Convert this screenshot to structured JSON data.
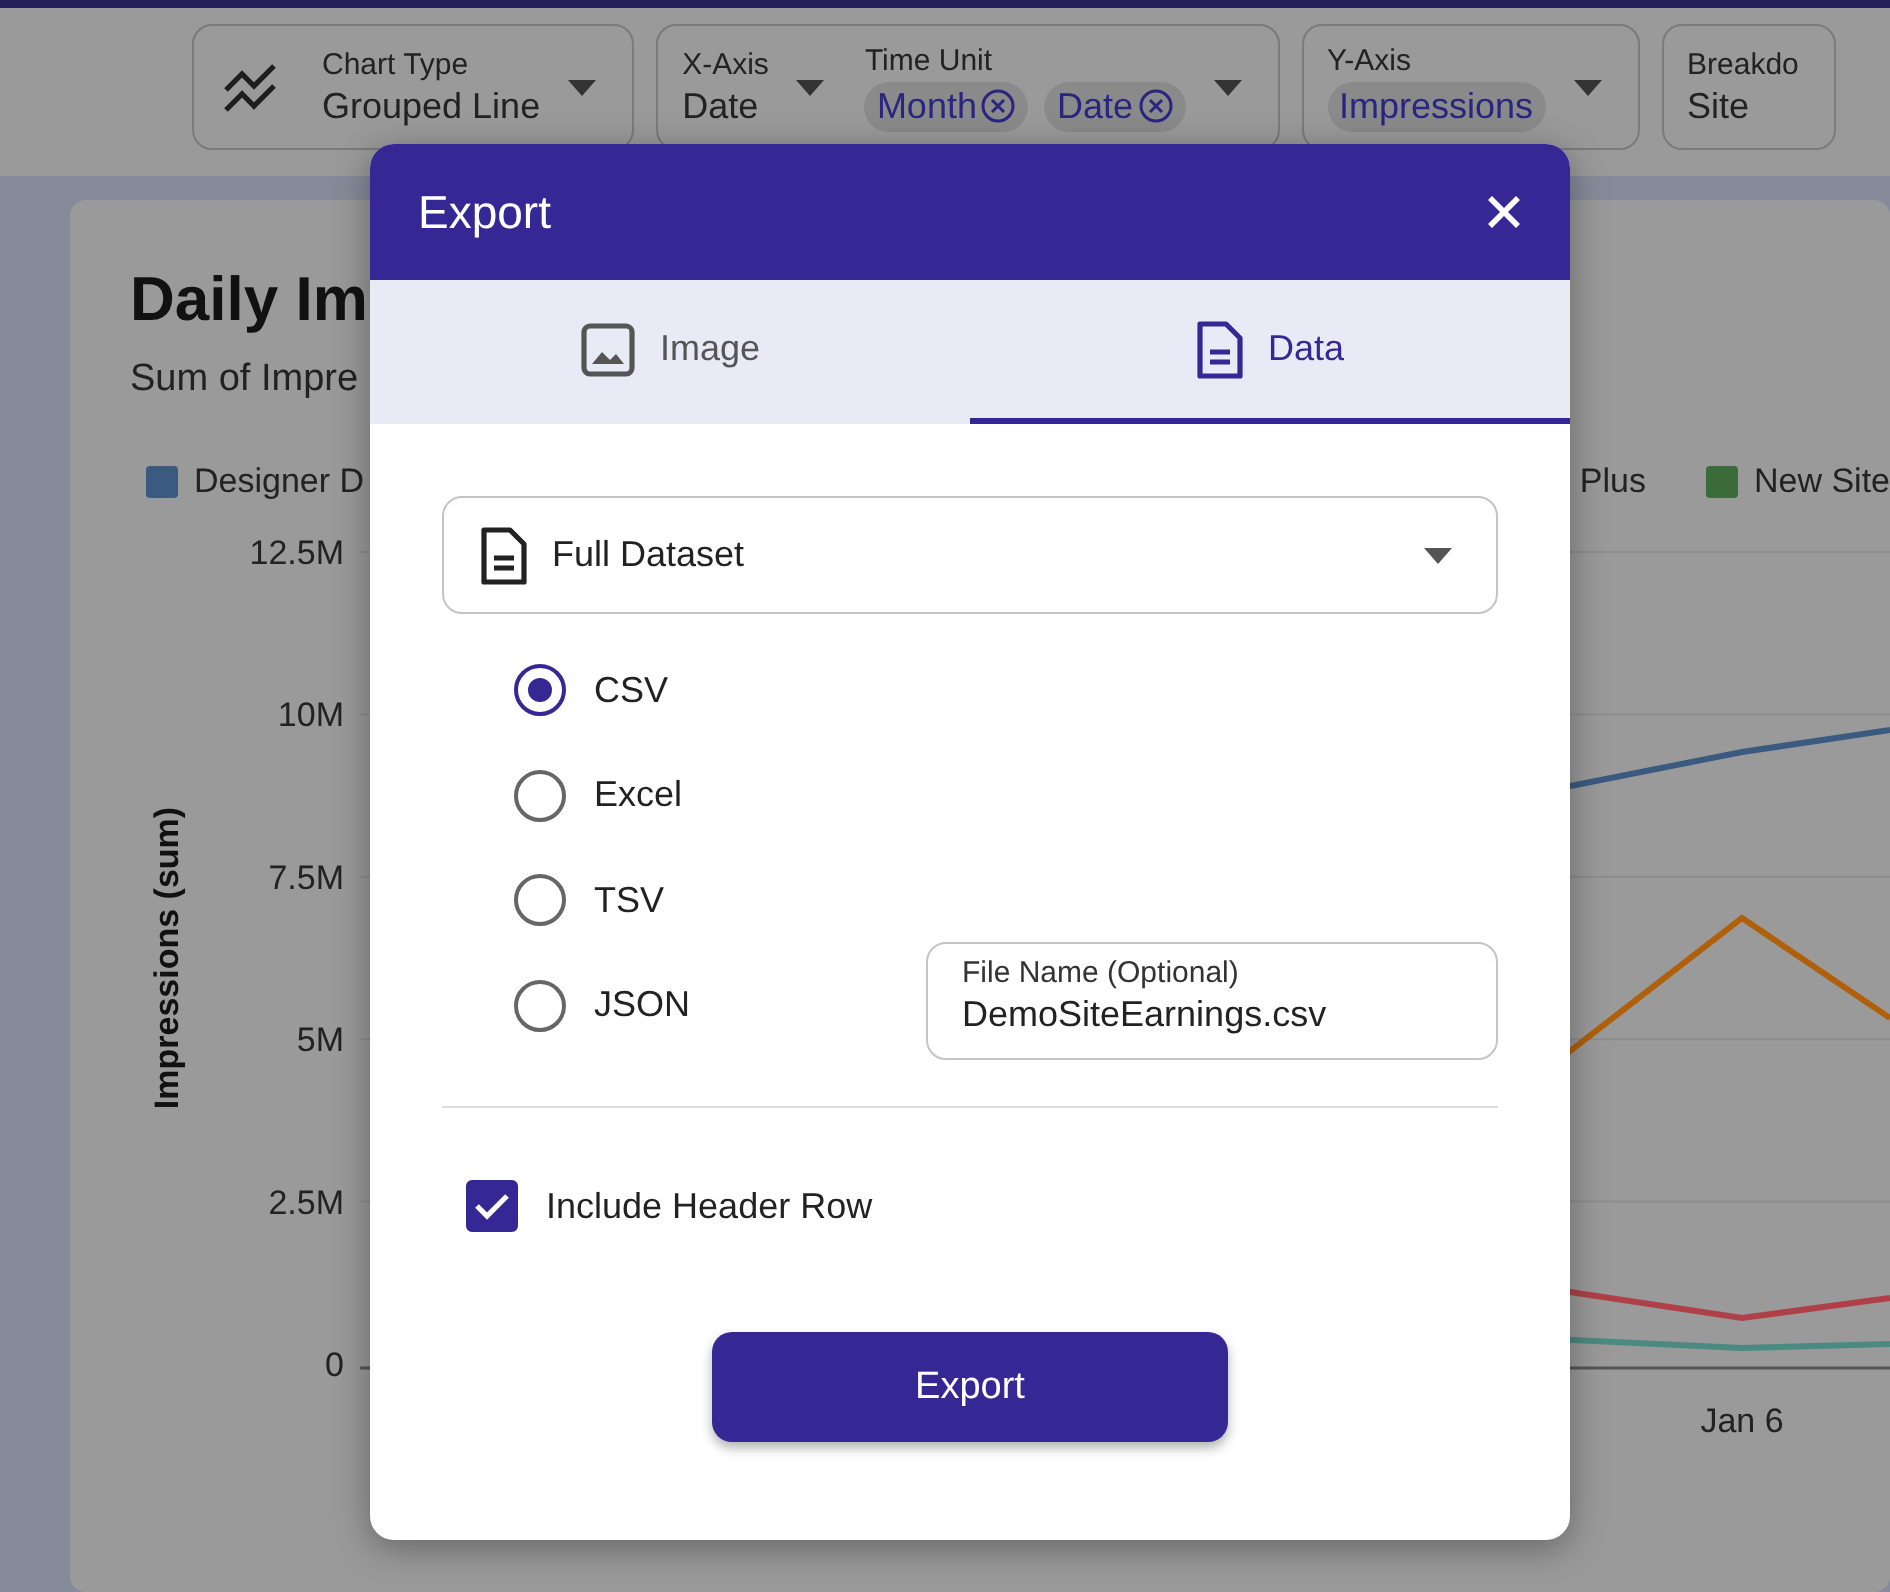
{
  "toolbar": {
    "filters": [
      {
        "kind": "chart-type",
        "fields": [
          {
            "label": "Chart Type",
            "value": "Grouped Line",
            "caret": true
          }
        ]
      },
      {
        "kind": "plain",
        "fields": [
          {
            "label": "X-Axis",
            "value": "Date",
            "caret": true
          },
          {
            "label": "Time Unit",
            "chips": [
              "Month",
              "Date"
            ],
            "caret": true
          }
        ]
      },
      {
        "kind": "plain",
        "fields": [
          {
            "label": "Y-Axis",
            "chips": [
              "Impressions"
            ],
            "caret": true
          }
        ]
      },
      {
        "kind": "plain",
        "fields": [
          {
            "label": "Breakdo",
            "value": "Site",
            "caret": false
          }
        ]
      }
    ]
  },
  "card": {
    "title": "Daily Im",
    "subtitle": "Sum of Impre",
    "legend": [
      {
        "label": "Designer D",
        "color": "#3b5a80"
      },
      {
        "label": "Plus"
      },
      {
        "label": "New Site",
        "color": "#3a6b38"
      }
    ],
    "chart": {
      "y_label": "Impressions (sum)",
      "y_ticks": [
        "12.5M",
        "10M",
        "7.5M",
        "5M",
        "2.5M",
        "0"
      ],
      "x_ticks": [
        "Jan 6"
      ]
    }
  },
  "dialog": {
    "title": "Export",
    "tabs": [
      {
        "label": "Image",
        "kind": "image",
        "selected": false
      },
      {
        "label": "Data",
        "kind": "data",
        "selected": true
      }
    ],
    "dataset": "Full Dataset",
    "formats": [
      {
        "label": "CSV",
        "selected": true
      },
      {
        "label": "Excel",
        "selected": false
      },
      {
        "label": "TSV",
        "selected": false
      },
      {
        "label": "JSON",
        "selected": false
      }
    ],
    "file_name": {
      "label": "File Name (Optional)",
      "value": "DemoSiteEarnings.csv"
    },
    "include_header": {
      "label": "Include Header Row",
      "checked": true
    },
    "export_button": "Export"
  }
}
